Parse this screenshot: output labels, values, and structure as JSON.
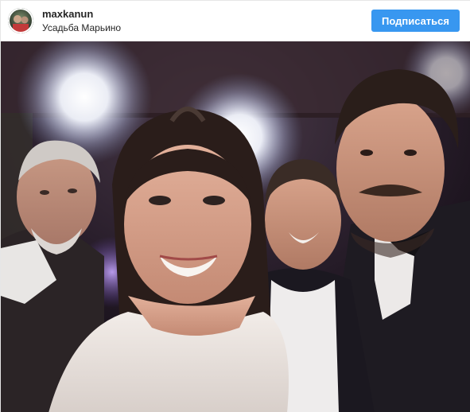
{
  "post": {
    "username": "maxkanun",
    "location": "Усадьба Марьино",
    "follow_label": "Подписаться"
  },
  "colors": {
    "follow_button": "#3897f0",
    "text": "#262626",
    "border": "#e6e6e6"
  },
  "icons": {
    "avatar": "profile-avatar"
  }
}
